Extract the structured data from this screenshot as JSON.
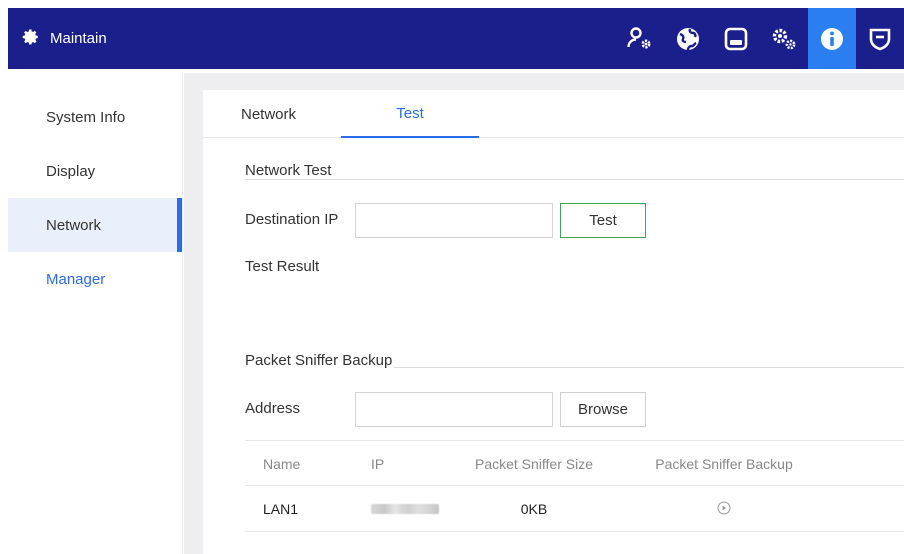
{
  "header": {
    "title": "Maintain",
    "icons": [
      "user-settings-icon",
      "network-globe-icon",
      "storage-icon",
      "system-gears-icon",
      "info-icon",
      "security-shield-icon"
    ],
    "active_icon": "info-icon",
    "colors": {
      "bar": "#1b1f8c",
      "active": "#2a7ef0"
    }
  },
  "sidebar": {
    "items": [
      {
        "label": "System Info"
      },
      {
        "label": "Display"
      },
      {
        "label": "Network"
      },
      {
        "label": "Manager"
      }
    ],
    "selected": "Network",
    "accent_color": "#2a6be8"
  },
  "tabs": [
    {
      "label": "Network"
    },
    {
      "label": "Test"
    }
  ],
  "active_tab": "Test",
  "network_test": {
    "section_title": "Network Test",
    "destination_label": "Destination IP",
    "destination_value": "",
    "test_button": "Test",
    "result_label": "Test Result"
  },
  "sniffer": {
    "section_title": "Packet Sniffer Backup",
    "address_label": "Address",
    "address_value": "",
    "browse_button": "Browse",
    "columns": [
      "Name",
      "IP",
      "Packet Sniffer Size",
      "Packet Sniffer Backup"
    ],
    "rows": [
      {
        "name": "LAN1",
        "size": "0KB"
      }
    ]
  }
}
